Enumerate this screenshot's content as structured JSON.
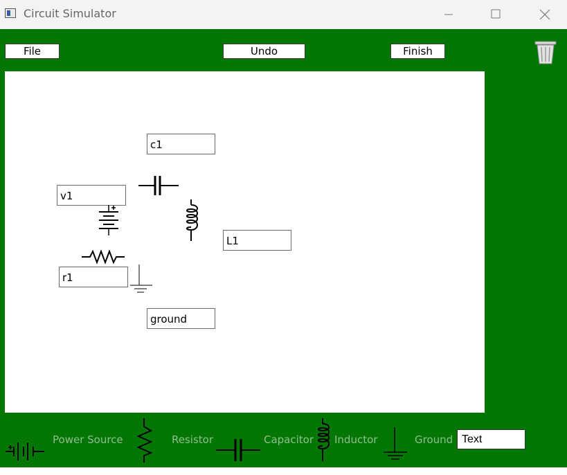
{
  "window": {
    "title": "Circuit Simulator",
    "controls": [
      "minimize",
      "maximize",
      "close"
    ]
  },
  "toolbar": {
    "file_label": "File",
    "undo_label": "Undo",
    "finish_label": "Finish",
    "trash_icon": "trash-icon"
  },
  "canvas": {
    "labels": {
      "c1": "c1",
      "v1": "v1",
      "L1": "L1",
      "r1": "r1",
      "ground": "ground"
    },
    "components": [
      "capacitor",
      "power-source",
      "inductor",
      "resistor",
      "ground"
    ]
  },
  "palette": {
    "items": [
      {
        "label": "Power Source",
        "icon": "power-source-icon"
      },
      {
        "label": "Resistor",
        "icon": "resistor-icon"
      },
      {
        "label": "Capacitor",
        "icon": "capacitor-icon"
      },
      {
        "label": "Inductor",
        "icon": "inductor-icon"
      },
      {
        "label": "Ground",
        "icon": "ground-icon"
      }
    ],
    "text_value": "Text"
  },
  "colors": {
    "background_green": "#037603",
    "palette_label": "#8fbf8f"
  }
}
